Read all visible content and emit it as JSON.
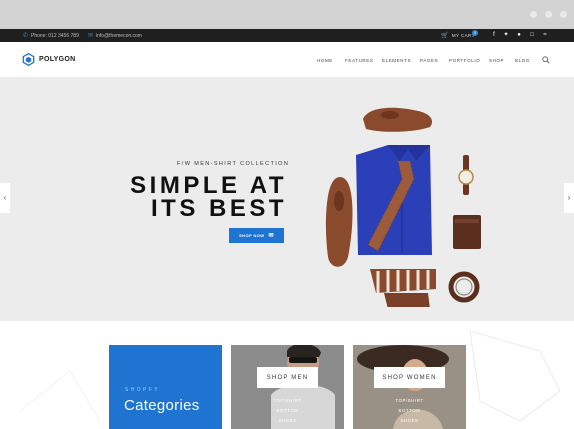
{
  "topbar": {
    "phone": "Phone: 012 3456 789",
    "email": "info@themecon.com",
    "cart_label": "MY CART",
    "cart_count": "0",
    "social_icons": [
      "facebook-icon",
      "twitter-icon",
      "pinterest-icon",
      "instagram-icon",
      "rss-icon"
    ]
  },
  "header": {
    "brand": "POLYGON",
    "nav": [
      "HOME",
      "FEATURES",
      "ELEMENTS",
      "PAGES",
      "PORTFOLIO",
      "SHOP",
      "BLOG"
    ]
  },
  "hero": {
    "subtitle": "F/W MEN-SHIRT COLLECTION",
    "headline_line1": "SIMPLE AT",
    "headline_line2": "ITS BEST",
    "button_label": "SHOP NOW"
  },
  "categories": {
    "kicker": "SHOPFY",
    "title": "Categories",
    "men": {
      "label": "SHOP MEN",
      "links": [
        "TOP/SHIRT",
        "BOTTOM",
        "SHOES"
      ]
    },
    "women": {
      "label": "SHOP WOMEN",
      "links": [
        "TOP/SHIRT",
        "BOTTOM",
        "SHOES"
      ]
    }
  },
  "colors": {
    "accent": "#1e74d0",
    "topbar_bg": "#1f1f1f",
    "hero_bg": "#ececec",
    "shirt": "#2a3fb8",
    "leather": "#8a4a2c"
  }
}
